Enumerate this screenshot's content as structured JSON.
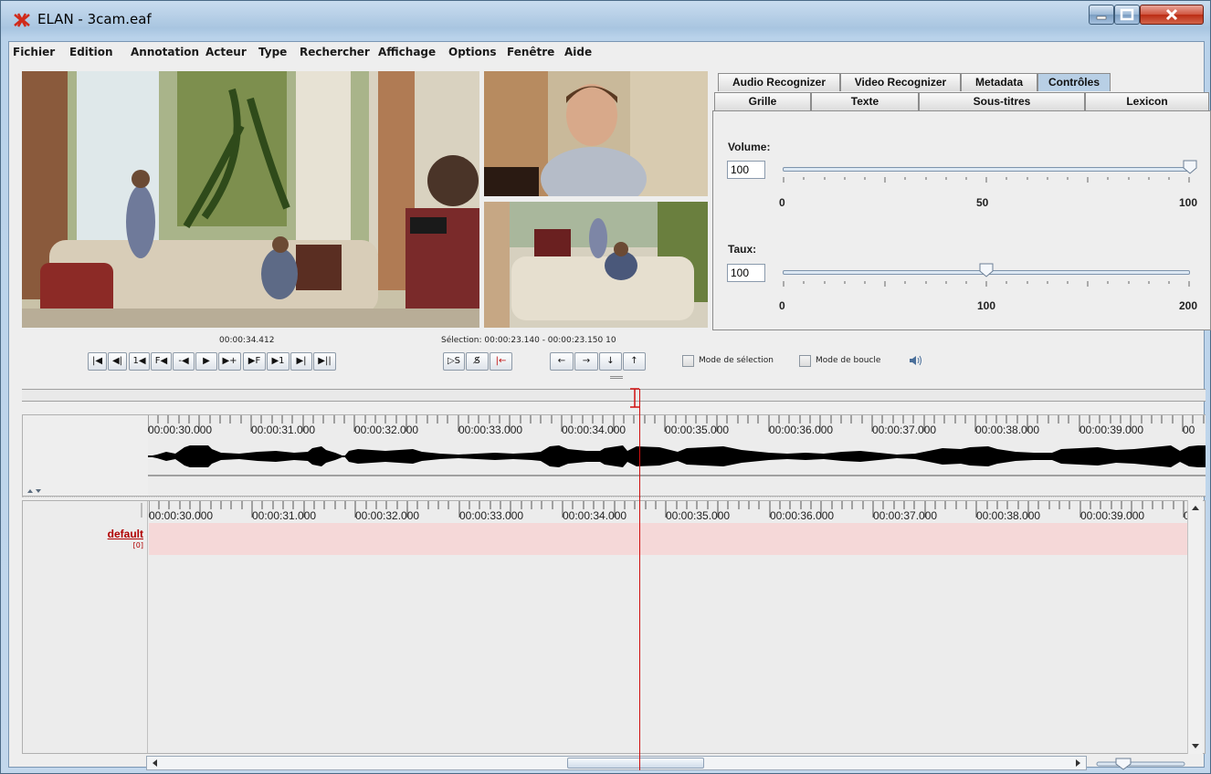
{
  "window": {
    "title": "ELAN - 3cam.eaf"
  },
  "menu": [
    "Fichier",
    "Edition",
    "Annotation",
    "Acteur",
    "Type",
    "Rechercher",
    "Affichage",
    "Options",
    "Fenêtre",
    "Aide"
  ],
  "tabs_row1": [
    "Audio Recognizer",
    "Video Recognizer",
    "Metadata",
    "Contrôles"
  ],
  "tabs_row2": [
    "Grille",
    "Texte",
    "Sous-titres",
    "Lexicon"
  ],
  "selected_tab": "Contrôles",
  "controls": {
    "volume": {
      "label": "Volume:",
      "value": "100",
      "level": 100,
      "ticks": [
        "0",
        "50",
        "100"
      ]
    },
    "rate": {
      "label": "Taux:",
      "value": "100",
      "level": 100,
      "ticks": [
        "0",
        "100",
        "200"
      ]
    }
  },
  "player": {
    "media_time": "00:00:34.412",
    "selection": "Sélection: 00:00:23.140 - 00:00:23.150  10",
    "buttons": [
      "|◀",
      "◀|",
      "1◀",
      "F◀",
      "-◀",
      "▶",
      "▶+",
      "▶F",
      "▶1",
      "▶|",
      "▶||"
    ],
    "selection_buttons": [
      "▷S",
      "S̸",
      "|←"
    ],
    "arrow_buttons": [
      "←",
      "→",
      "↓",
      "↑"
    ],
    "mode_selection": "Mode de sélection",
    "mode_loop": "Mode de boucle",
    "volume_icon": "speaker-icon"
  },
  "timeline": {
    "ticks": [
      "00:00:30.000",
      "00:00:31.000",
      "00:00:32.000",
      "00:00:33.000",
      "00:00:34.000",
      "00:00:35.000",
      "00:00:36.000",
      "00:00:37.000",
      "00:00:38.000",
      "00:00:39.000",
      "00"
    ],
    "tier": {
      "name": "default",
      "count": "[0]"
    }
  },
  "colors": {
    "cursor": "#d01010",
    "tier_bg": "#f5d8d8",
    "tab_selected": "#b8cfe5"
  }
}
